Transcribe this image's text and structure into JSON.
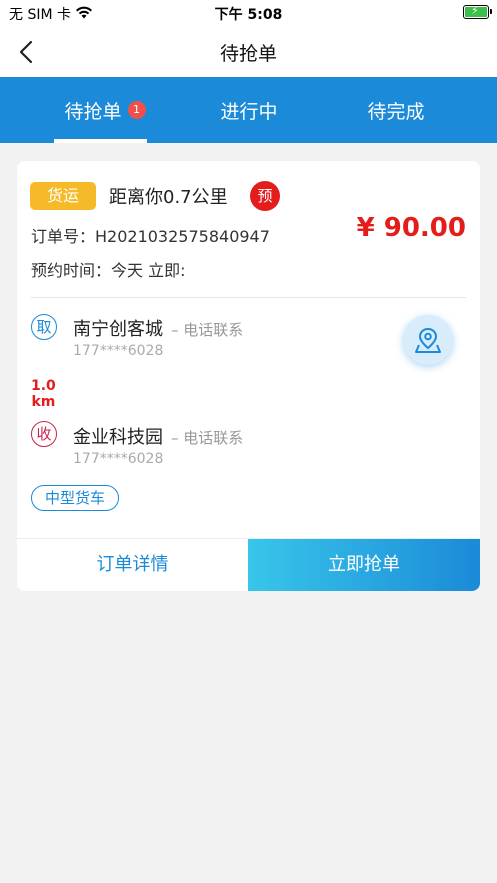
{
  "status_bar": {
    "carrier": "无 SIM 卡",
    "time": "下午 5:08",
    "battery_level": 0.9
  },
  "nav": {
    "title": "待抢单"
  },
  "tabs": [
    {
      "label": "待抢单",
      "badge": "1",
      "active": true
    },
    {
      "label": "进行中"
    },
    {
      "label": "待完成"
    }
  ],
  "order": {
    "tag": "货运",
    "distance": "距离你0.7公里",
    "pre_badge": "预",
    "order_no": "订单号：H2021032575840947",
    "price": "¥ 90.00",
    "appointment": "预约时间：今天 立即:",
    "pickup": {
      "icon_label": "取",
      "name": "南宁创客城",
      "contact": "– 电话联系",
      "phone": "177****6028"
    },
    "route_distance": {
      "value": "1.0",
      "unit": "km"
    },
    "delivery": {
      "icon_label": "收",
      "name": "金业科技园",
      "contact": "– 电话联系",
      "phone": "177****6028"
    },
    "vehicle": "中型货车",
    "detail_button": "订单详情",
    "grab_button": "立即抢单"
  },
  "colors": {
    "primary": "#1b8ad8",
    "price_red": "#e51c1c",
    "tag_yellow": "#f6b928",
    "receive_red": "#c8264a"
  },
  "icons": {
    "back": "chevron-left-icon",
    "wifi": "wifi-icon",
    "battery": "battery-icon",
    "map": "map-pin-icon"
  }
}
